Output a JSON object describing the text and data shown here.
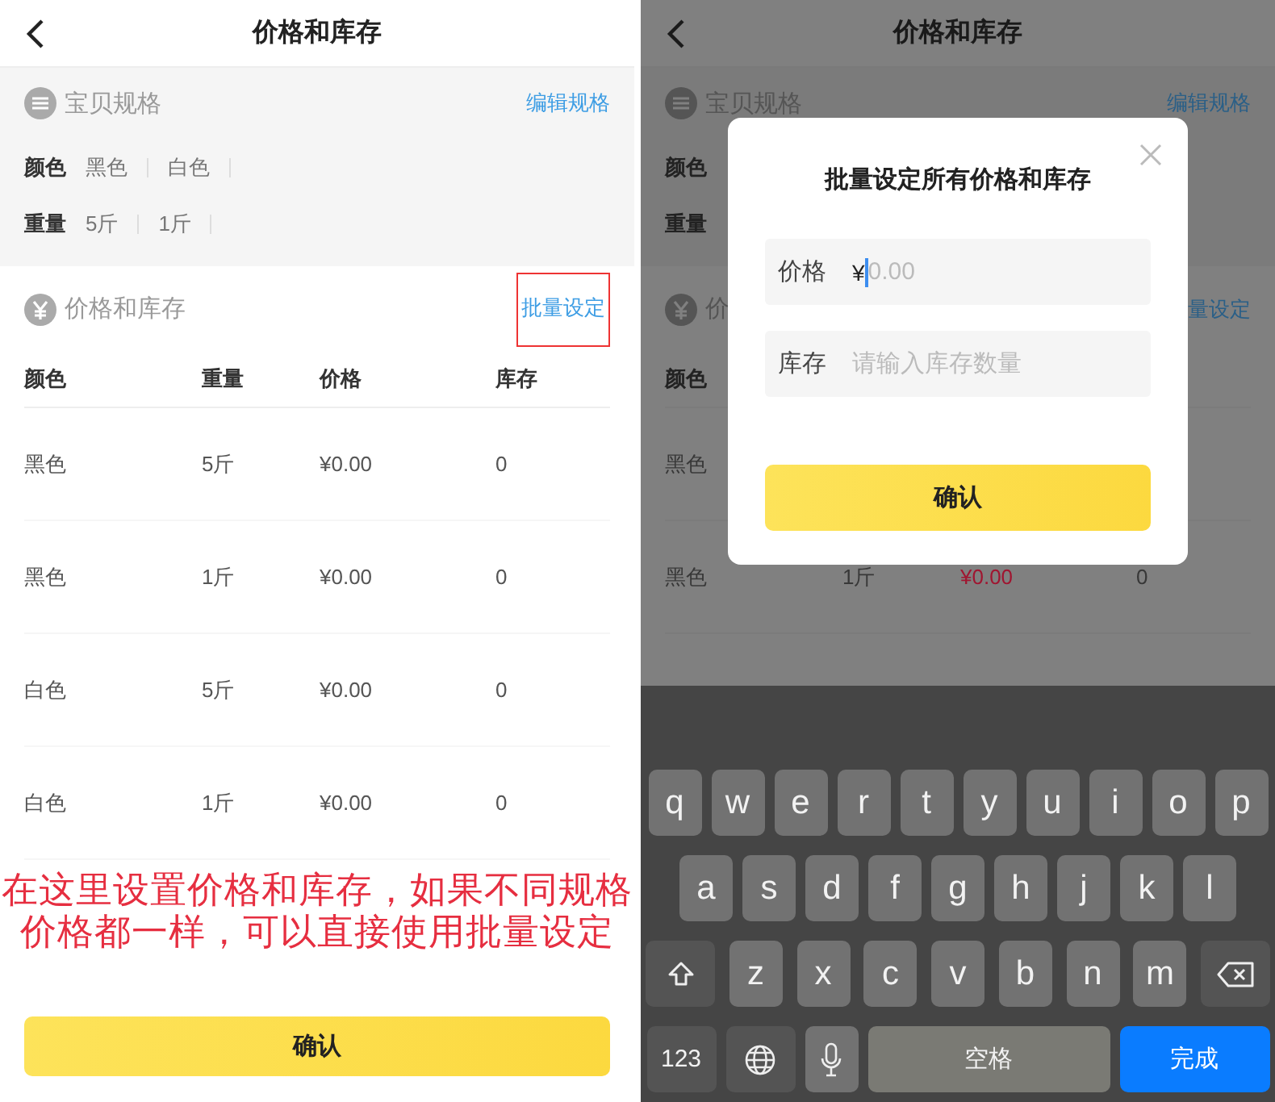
{
  "page": {
    "title": "价格和库存",
    "spec_section": {
      "title": "宝贝规格",
      "edit_link": "编辑规格",
      "specs": [
        {
          "label": "颜色",
          "values": [
            "黑色",
            "白色"
          ]
        },
        {
          "label": "重量",
          "values": [
            "5斤",
            "1斤"
          ]
        }
      ]
    },
    "price_section": {
      "title": "价格和库存",
      "batch_link": "批量设定",
      "highlighted": true,
      "columns": [
        "颜色",
        "重量",
        "价格",
        "库存"
      ],
      "rows": [
        [
          "黑色",
          "5斤",
          "¥0.00",
          "0"
        ],
        [
          "黑色",
          "1斤",
          "¥0.00",
          "0"
        ],
        [
          "白色",
          "5斤",
          "¥0.00",
          "0"
        ],
        [
          "白色",
          "1斤",
          "¥0.00",
          "0"
        ]
      ]
    },
    "note": "在这里设置价格和库存，如果不同规格价格都一样，可以直接使用批量设定",
    "confirm_button": "确认"
  },
  "dimmed_page": {
    "title": "价格和库存",
    "spec_section": {
      "title": "宝贝规格",
      "edit_link": "编辑规格",
      "spec_labels": [
        "颜色",
        "重量"
      ]
    },
    "price_section": {
      "title": "价",
      "batch_link": "量设定",
      "columns": [
        "颜色"
      ],
      "rows": [
        [
          "黑色"
        ],
        [
          "黑色",
          "1斤",
          "¥0.00",
          "0"
        ]
      ]
    }
  },
  "dialog": {
    "title": "批量设定所有价格和库存",
    "fields": [
      {
        "label": "价格",
        "prefix": "¥",
        "placeholder": "0.00",
        "focused": true
      },
      {
        "label": "库存",
        "placeholder": "请输入库存数量",
        "focused": false
      }
    ],
    "confirm_button": "确认"
  },
  "keyboard": {
    "letter_rows": [
      [
        "q",
        "w",
        "e",
        "r",
        "t",
        "y",
        "u",
        "i",
        "o",
        "p"
      ],
      [
        "a",
        "s",
        "d",
        "f",
        "g",
        "h",
        "j",
        "k",
        "l"
      ],
      [
        "z",
        "x",
        "c",
        "v",
        "b",
        "n",
        "m"
      ]
    ],
    "number_key": "123",
    "space_key": "空格",
    "done_key": "完成"
  }
}
